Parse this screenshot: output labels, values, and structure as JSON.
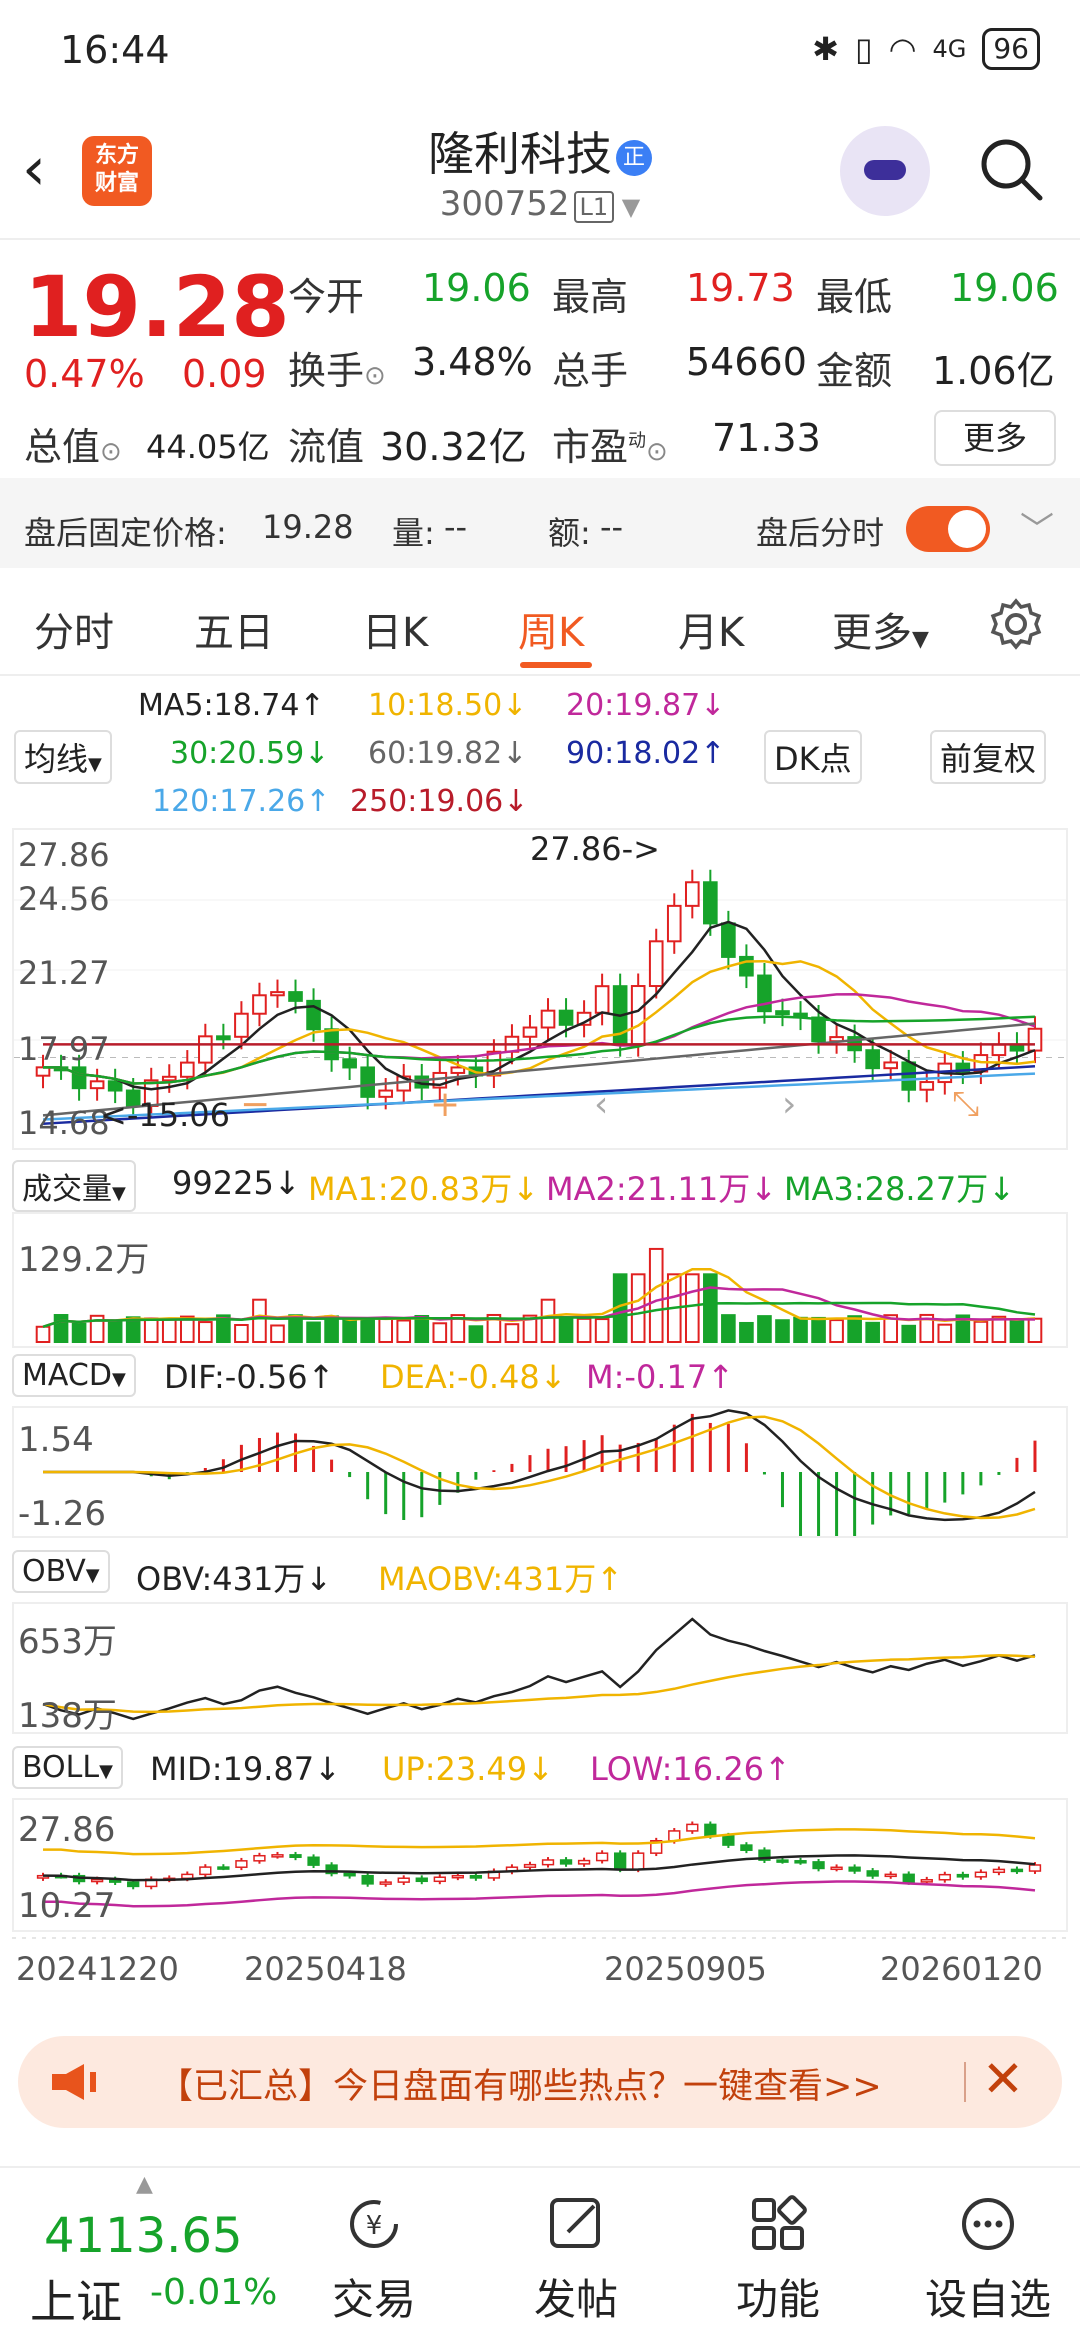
{
  "status_bar": {
    "time": "16:44",
    "battery": "96",
    "network": "4G"
  },
  "header": {
    "title": "隆利科技",
    "badge": "正",
    "code": "300752",
    "market_tag": "L1",
    "logo_line1": "东方",
    "logo_line2": "财富"
  },
  "quote": {
    "price": "19.28",
    "change_pct": "0.47%",
    "change": "0.09",
    "open_label": "今开",
    "open": "19.06",
    "high_label": "最高",
    "high": "19.73",
    "low_label": "最低",
    "low": "19.06",
    "turnover_label": "换手",
    "turnover": "3.48%",
    "volume_label": "总手",
    "volume": "54660",
    "amount_label": "金额",
    "amount": "1.06亿",
    "mktcap_label": "总值",
    "mktcap": "44.05亿",
    "float_label": "流值",
    "float": "30.32亿",
    "pe_label": "市盈",
    "pe_sup": "动",
    "pe": "71.33",
    "more_label": "更多"
  },
  "after_hours": {
    "price_label": "盘后固定价格:",
    "price": "19.28",
    "vol_label": "量:",
    "vol": "--",
    "amt_label": "额:",
    "amt": "--",
    "toggle_label": "盘后分时"
  },
  "tabs": [
    "分时",
    "五日",
    "日K",
    "周K",
    "月K",
    "更多"
  ],
  "active_tab": "周K",
  "ma_legend": {
    "selector": "均线",
    "ma5": "MA5:18.74↑",
    "ma10": "10:18.50↓",
    "ma20": "20:19.87↓",
    "ma30": "30:20.59↓",
    "ma60": "60:19.82↓",
    "ma90": "90:18.02↑",
    "ma120": "120:17.26↑",
    "ma250": "250:19.06↓",
    "dk_button": "DK点",
    "fq_button": "前复权"
  },
  "kline_axis": {
    "y1": "27.86",
    "y2": "24.56",
    "y3": "21.27",
    "y4": "17.97",
    "y5": "14.68",
    "max_note": "27.86->",
    "min_note": "<-15.06"
  },
  "volume_panel": {
    "selector": "成交量",
    "value": "99225↓",
    "ma1": "MA1:20.83万↓",
    "ma2": "MA2:21.11万↓",
    "ma3": "MA3:28.27万↓",
    "axis_top": "129.2万"
  },
  "macd_panel": {
    "selector": "MACD",
    "dif": "DIF:-0.56↑",
    "dea": "DEA:-0.48↓",
    "m": "M:-0.17↑",
    "axis_top": "1.54",
    "axis_bottom": "-1.26"
  },
  "obv_panel": {
    "selector": "OBV",
    "obv": "OBV:431万↓",
    "maobv": "MAOBV:431万↑",
    "axis_top": "653万",
    "axis_bottom": "138万"
  },
  "boll_panel": {
    "selector": "BOLL",
    "mid": "MID:19.87↓",
    "up": "UP:23.49↓",
    "low": "LOW:16.26↑",
    "axis_top": "27.86",
    "axis_bottom": "10.27"
  },
  "dates": [
    "20241220",
    "20250418",
    "20250905",
    "20260120"
  ],
  "banner": {
    "text": "【已汇总】今日盘面有哪些热点？一键查看>>"
  },
  "bottom_nav": {
    "index_value": "4113.65",
    "index_name": "上证",
    "index_change": "-0.01%",
    "trade": "交易",
    "post": "发帖",
    "function": "功能",
    "watchlist": "设自选"
  },
  "colors": {
    "up": "#e02020",
    "down": "#16a32a",
    "accent": "#f15a22",
    "ma5": "#222222",
    "ma10": "#f0b400",
    "ma20": "#c0289b",
    "ma30": "#16a32a",
    "ma60": "#666666",
    "ma90": "#1a2aa0",
    "ma120": "#4aa8e8",
    "ma250": "#b81c2a"
  }
}
